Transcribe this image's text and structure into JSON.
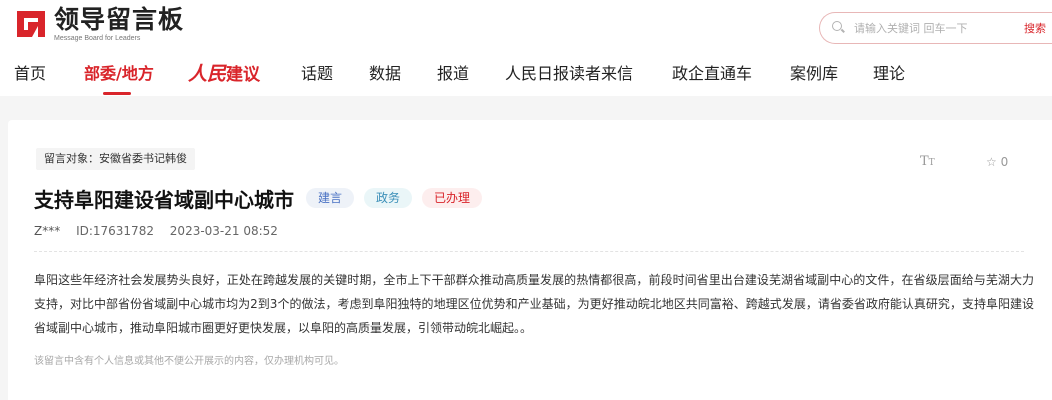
{
  "header": {
    "logo_title": "领导留言板",
    "logo_subtitle": "Message Board for Leaders",
    "search": {
      "placeholder": "请输入关键词 回车一下",
      "button": "搜索"
    }
  },
  "nav": {
    "items": [
      {
        "label": "首页"
      },
      {
        "label": "部委/地方",
        "active": true
      },
      {
        "label_script": "人民",
        "label_rest": "建议"
      },
      {
        "label": "话题"
      },
      {
        "label": "数据"
      },
      {
        "label": "报道"
      },
      {
        "label": "人民日报读者来信"
      },
      {
        "label": "政企直通车"
      },
      {
        "label": "案例库"
      },
      {
        "label": "理论"
      }
    ]
  },
  "message": {
    "target": "留言对象：安徽省委书记韩俊",
    "font_toggle": "TT",
    "favorite_count": "0",
    "title": "支持阜阳建设省域副中心城市",
    "tags": [
      "建言",
      "政务",
      "已办理"
    ],
    "author": "Z***",
    "id": "ID:17631782",
    "time": "2023-03-21 08:52",
    "body": "阜阳这些年经济社会发展势头良好，正处在跨越发展的关键时期，全市上下干部群众推动高质量发展的热情都很高，前段时间省里出台建设芜湖省域副中心的文件，在省级层面给与芜湖大力支持，对比中部省份省域副中心城市均为2到3个的做法，考虑到阜阳独特的地理区位优势和产业基础，为更好推动皖北地区共同富裕、跨越式发展，请省委省政府能认真研究，支持阜阳建设省域副中心城市，推动阜阳城市圈更好更快发展，以阜阳的高质量发展，引领带动皖北崛起。。",
    "notice": "该留言中含有个人信息或其他不便公开展示的内容，仅办理机构可见。"
  },
  "colors": {
    "brand_red": "#d9252b",
    "tag_blue": "#4a72c3",
    "tag_cyan": "#3b8fb8"
  },
  "icons": [
    "logo-mark-icon",
    "search-icon",
    "font-size-icon",
    "star-icon"
  ]
}
